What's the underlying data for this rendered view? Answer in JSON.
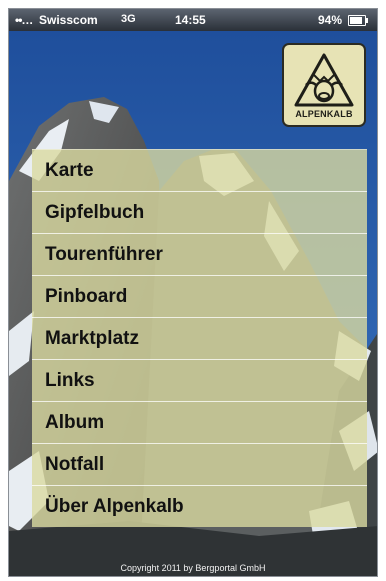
{
  "status_bar": {
    "signal": "••…",
    "carrier": "Swisscom",
    "network": "3G",
    "time": "14:55",
    "battery": "94%"
  },
  "logo": {
    "text": "ALPENKALB",
    "icon": "alpenkalb-cow-mountain-logo"
  },
  "menu": {
    "items": [
      {
        "label": "Karte"
      },
      {
        "label": "Gipfelbuch"
      },
      {
        "label": "Tourenführer"
      },
      {
        "label": "Pinboard"
      },
      {
        "label": "Marktplatz"
      },
      {
        "label": "Links"
      },
      {
        "label": "Album"
      },
      {
        "label": "Notfall"
      },
      {
        "label": "Über Alpenkalb"
      }
    ]
  },
  "footer": {
    "copyright": "Copyright 2011 by Bergportal GmbH"
  },
  "colors": {
    "sky": "#2d5ea8",
    "menu_background": "#dad9a0",
    "logo_background": "#e7e3b5"
  }
}
